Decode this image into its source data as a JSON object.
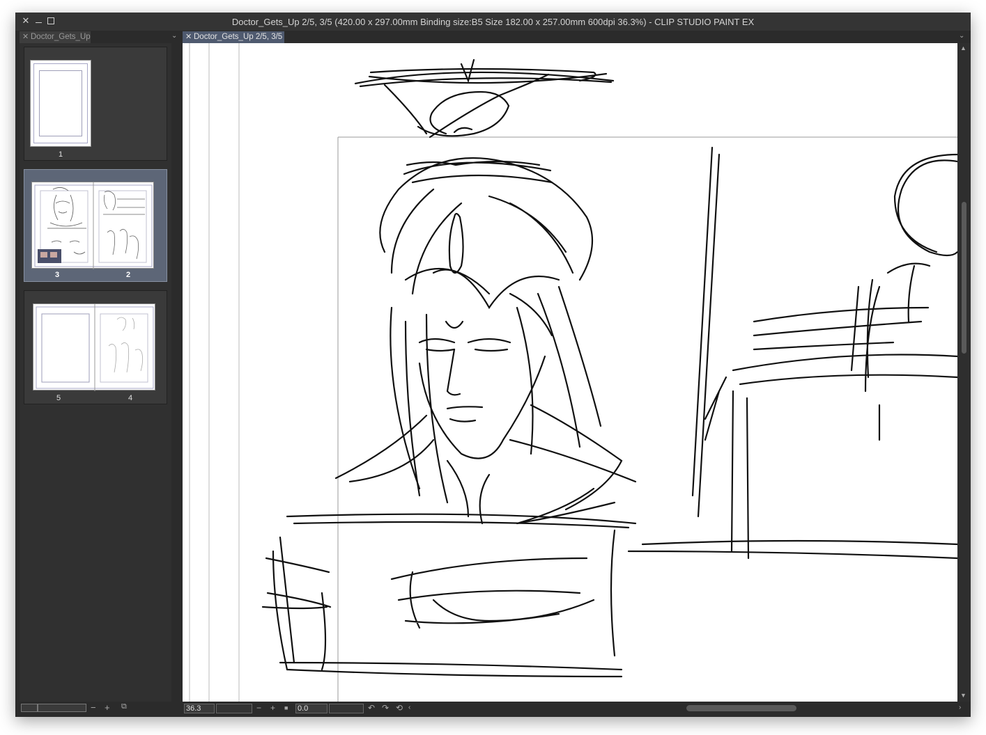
{
  "window": {
    "title": "Doctor_Gets_Up 2/5, 3/5 (420.00 x 297.00mm Binding size:B5 Size 182.00 x 257.00mm 600dpi 36.3%)  - CLIP STUDIO PAINT EX"
  },
  "left_panel": {
    "tab_label": "Doctor_Gets_Up",
    "pages": [
      {
        "numbers": [
          "1"
        ],
        "selected": false
      },
      {
        "numbers": [
          "3",
          "2"
        ],
        "selected": true
      },
      {
        "numbers": [
          "5",
          "4"
        ],
        "selected": false
      }
    ]
  },
  "doc_tab": {
    "label": "Doctor_Gets_Up 2/5, 3/5"
  },
  "status": {
    "zoom": "36.3",
    "rotation": "0.0"
  },
  "icons": {
    "close": "close-icon",
    "minimize": "minimize-icon",
    "maximize": "maximize-icon",
    "chevron": "chevron-down-icon",
    "zoom_out": "minus-icon",
    "zoom_in": "plus-icon",
    "rotate_left": "rotate-left-icon",
    "rotate_right": "rotate-right-icon",
    "reset_rotation": "reset-rotation-icon",
    "flip": "flip-icon"
  }
}
